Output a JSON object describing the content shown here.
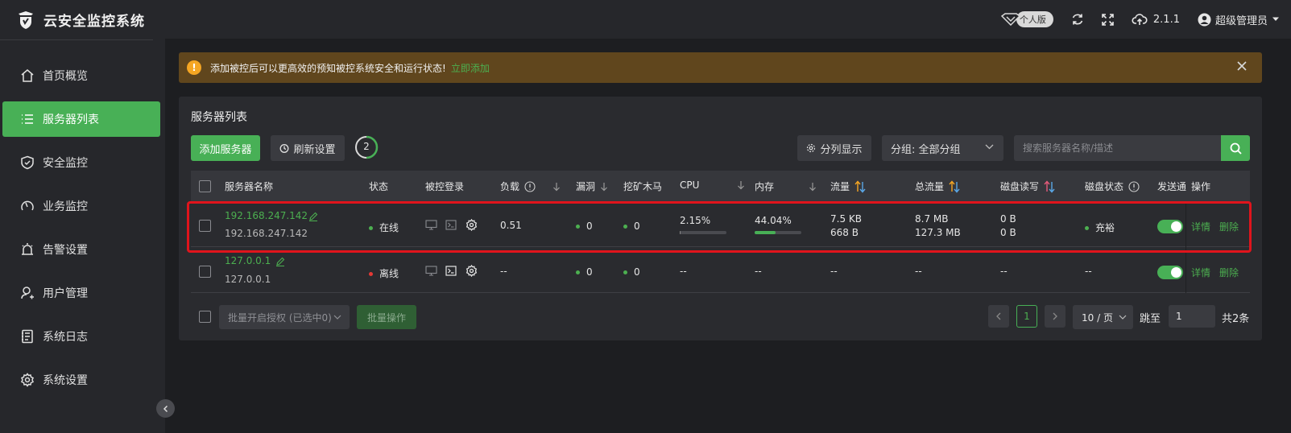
{
  "app": {
    "title": "云安全监控系统"
  },
  "topbar": {
    "edition": "个人版",
    "version": "2.1.1",
    "user": "超级管理员"
  },
  "sidebar": {
    "items": [
      {
        "label": "首页概览",
        "icon": "home-icon",
        "active": false
      },
      {
        "label": "服务器列表",
        "icon": "list-icon",
        "active": true
      },
      {
        "label": "安全监控",
        "icon": "shield-icon",
        "active": false
      },
      {
        "label": "业务监控",
        "icon": "gauge-icon",
        "active": false
      },
      {
        "label": "告警设置",
        "icon": "alarm-icon",
        "active": false
      },
      {
        "label": "用户管理",
        "icon": "user-icon",
        "active": false
      },
      {
        "label": "系统日志",
        "icon": "log-icon",
        "active": false
      },
      {
        "label": "系统设置",
        "icon": "gear-icon",
        "active": false
      }
    ]
  },
  "alert": {
    "message": "添加被控后可以更高效的预知被控系统安全和运行状态!",
    "link": "立即添加"
  },
  "panel": {
    "title": "服务器列表",
    "add_button": "添加服务器",
    "refresh_button": "刷新设置",
    "refresh_count": "2",
    "column_button": "分列显示",
    "group_select": "分组: 全部分组",
    "search_placeholder": "搜索服务器名称/描述"
  },
  "table": {
    "headers": {
      "name": "服务器名称",
      "status": "状态",
      "login": "被控登录",
      "load": "负载",
      "vuln": "漏洞",
      "miner": "挖矿木马",
      "cpu": "CPU",
      "mem": "内存",
      "traffic": "流量",
      "total_traffic": "总流量",
      "disk_rw": "磁盘读写",
      "disk_status": "磁盘状态",
      "notify": "发送通",
      "ops": "操作"
    },
    "rows": [
      {
        "name": "192.168.247.142",
        "desc": "192.168.247.142",
        "status": "在线",
        "status_color": "#4caf50",
        "load": "0.51",
        "vuln": "0",
        "miner": "0",
        "cpu": "2.15%",
        "cpu_pct": 2.15,
        "mem": "44.04%",
        "mem_pct": 44.04,
        "traffic_up": "7.5 KB",
        "traffic_down": "668 B",
        "total_up": "8.7 MB",
        "total_down": "127.3 MB",
        "disk_r": "0 B",
        "disk_w": "0 B",
        "disk_status": "充裕",
        "notify_on": true,
        "detail": "详情",
        "delete": "删除"
      },
      {
        "name": "127.0.0.1",
        "desc": "127.0.0.1",
        "status": "离线",
        "status_color": "#e53935",
        "load": "--",
        "vuln": "0",
        "miner": "0",
        "cpu": "--",
        "mem": "--",
        "traffic": "--",
        "total": "--",
        "disk_rw": "--",
        "disk_status": "--",
        "notify_on": true,
        "detail": "详情",
        "delete": "删除"
      }
    ]
  },
  "footer": {
    "batch_select": "批量开启授权 (已选中0)",
    "batch_button": "批量操作",
    "page": "1",
    "page_size": "10 / 页",
    "jump_label": "跳至",
    "jump_value": "1",
    "total": "共2条"
  }
}
